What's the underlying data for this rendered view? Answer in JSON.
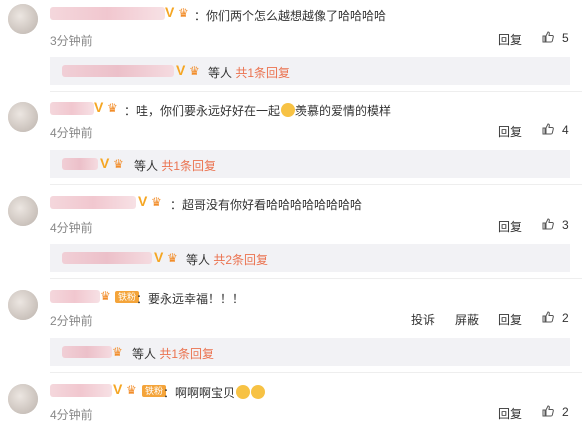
{
  "comments": [
    {
      "text": "你们两个怎么越想越像了哈哈哈哈",
      "time": "3分钟前",
      "reply_label": "回复",
      "likes": "5"
    },
    {
      "text": "哇，你们要永远好好在一起",
      "text2": "羡慕的爱情的模样",
      "time": "4分钟前",
      "reply_label": "回复",
      "likes": "4"
    },
    {
      "text": "超哥没有你好看哈哈哈哈哈哈哈哈",
      "time": "4分钟前",
      "reply_label": "回复",
      "likes": "3"
    },
    {
      "text": "要永远幸福！！！",
      "time": "2分钟前",
      "report_label": "投诉",
      "block_label": "屏蔽",
      "reply_label": "回复",
      "likes": "2"
    },
    {
      "text": "啊啊啊宝贝",
      "time": "4分钟前",
      "reply_label": "回复",
      "likes": "2"
    }
  ],
  "replies": [
    {
      "others": "等人",
      "count_text": "共1条回复"
    },
    {
      "others": "等人",
      "count_text": "共1条回复"
    },
    {
      "others": "等人",
      "count_text": "共2条回复"
    },
    {
      "others": "等人",
      "count_text": "共1条回复"
    }
  ],
  "fan_badge": "铁粉",
  "colors": {
    "link": "#eb7350",
    "badge": "#f5a623",
    "reply_bg": "#f2f2f5"
  }
}
